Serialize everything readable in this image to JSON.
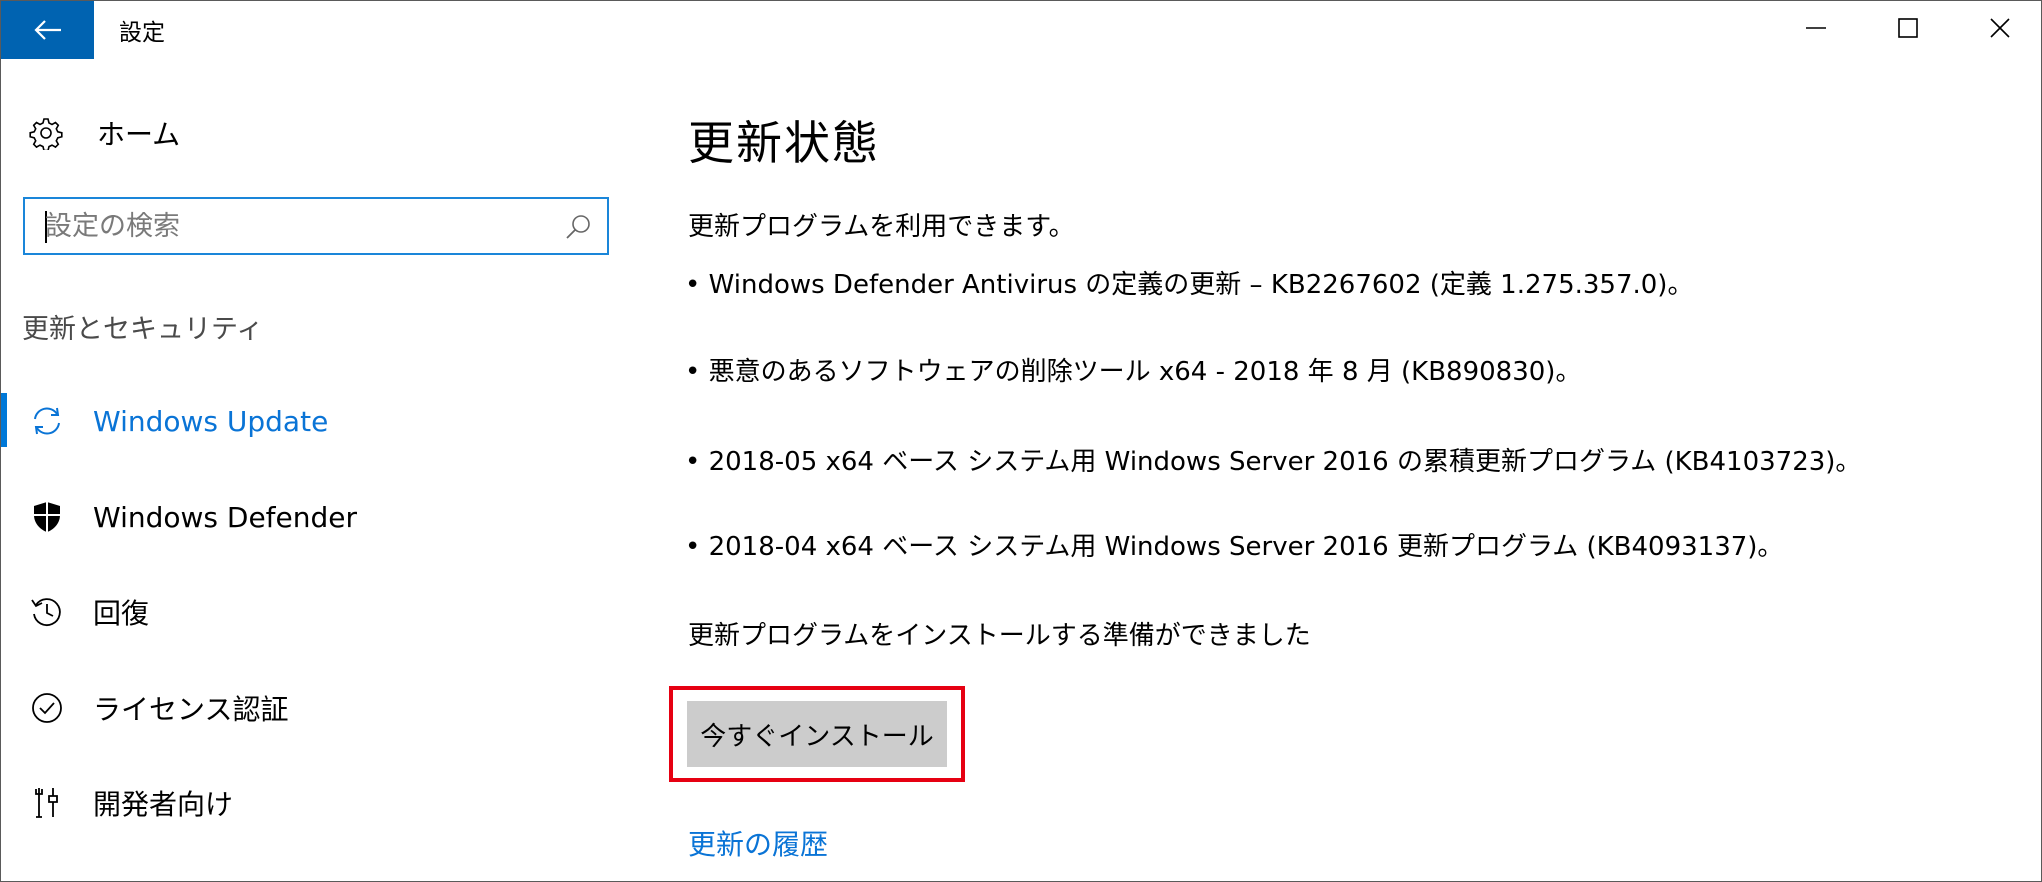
{
  "window": {
    "title": "設定",
    "accent_color": "#0063b1"
  },
  "sidebar": {
    "home_label": "ホーム",
    "search": {
      "placeholder": "設定の検索",
      "value": ""
    },
    "section_heading": "更新とセキュリティ",
    "items": [
      {
        "label": "Windows Update",
        "icon": "sync-icon",
        "active": true
      },
      {
        "label": "Windows Defender",
        "icon": "shield-icon",
        "active": false
      },
      {
        "label": "回復",
        "icon": "history-icon",
        "active": false
      },
      {
        "label": "ライセンス認証",
        "icon": "checkmark-circle-icon",
        "active": false
      },
      {
        "label": "開発者向け",
        "icon": "developer-tools-icon",
        "active": false
      }
    ],
    "active_color": "#0a74d6"
  },
  "main": {
    "title": "更新状態",
    "available_text": "更新プログラムを利用できます。",
    "updates": [
      "• Windows Defender Antivirus の定義の更新 – KB2267602 (定義 1.275.357.0)。",
      "• 悪意のあるソフトウェアの削除ツール x64 - 2018 年 8 月 (KB890830)。",
      "• 2018-05 x64 ベース システム用 Windows Server 2016 の累積更新プログラム (KB4103723)。",
      "• 2018-04 x64 ベース システム用 Windows Server 2016 更新プログラム (KB4093137)。"
    ],
    "ready_text": "更新プログラムをインストールする準備ができました",
    "install_button_label": "今すぐインストール",
    "history_link_label": "更新の履歴",
    "highlight_color": "#e60012"
  }
}
